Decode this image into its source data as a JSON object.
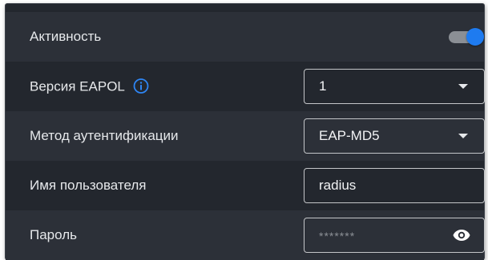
{
  "settings": {
    "active": {
      "label": "Активность",
      "enabled": true
    },
    "eapol_version": {
      "label": "Версия EAPOL",
      "value": "1",
      "icon": "info-icon"
    },
    "auth_method": {
      "label": "Метод аутентификации",
      "value": "EAP-MD5"
    },
    "username": {
      "label": "Имя пользователя",
      "value": "radius"
    },
    "password": {
      "label": "Пароль",
      "value": "*******",
      "icon": "eye-icon"
    }
  },
  "colors": {
    "accent": "#1e7bf0",
    "panel_bg": "#23272e",
    "row_stripe": "#2c3038",
    "text": "#e6e8eb",
    "control_border": "#c4c6c9"
  }
}
